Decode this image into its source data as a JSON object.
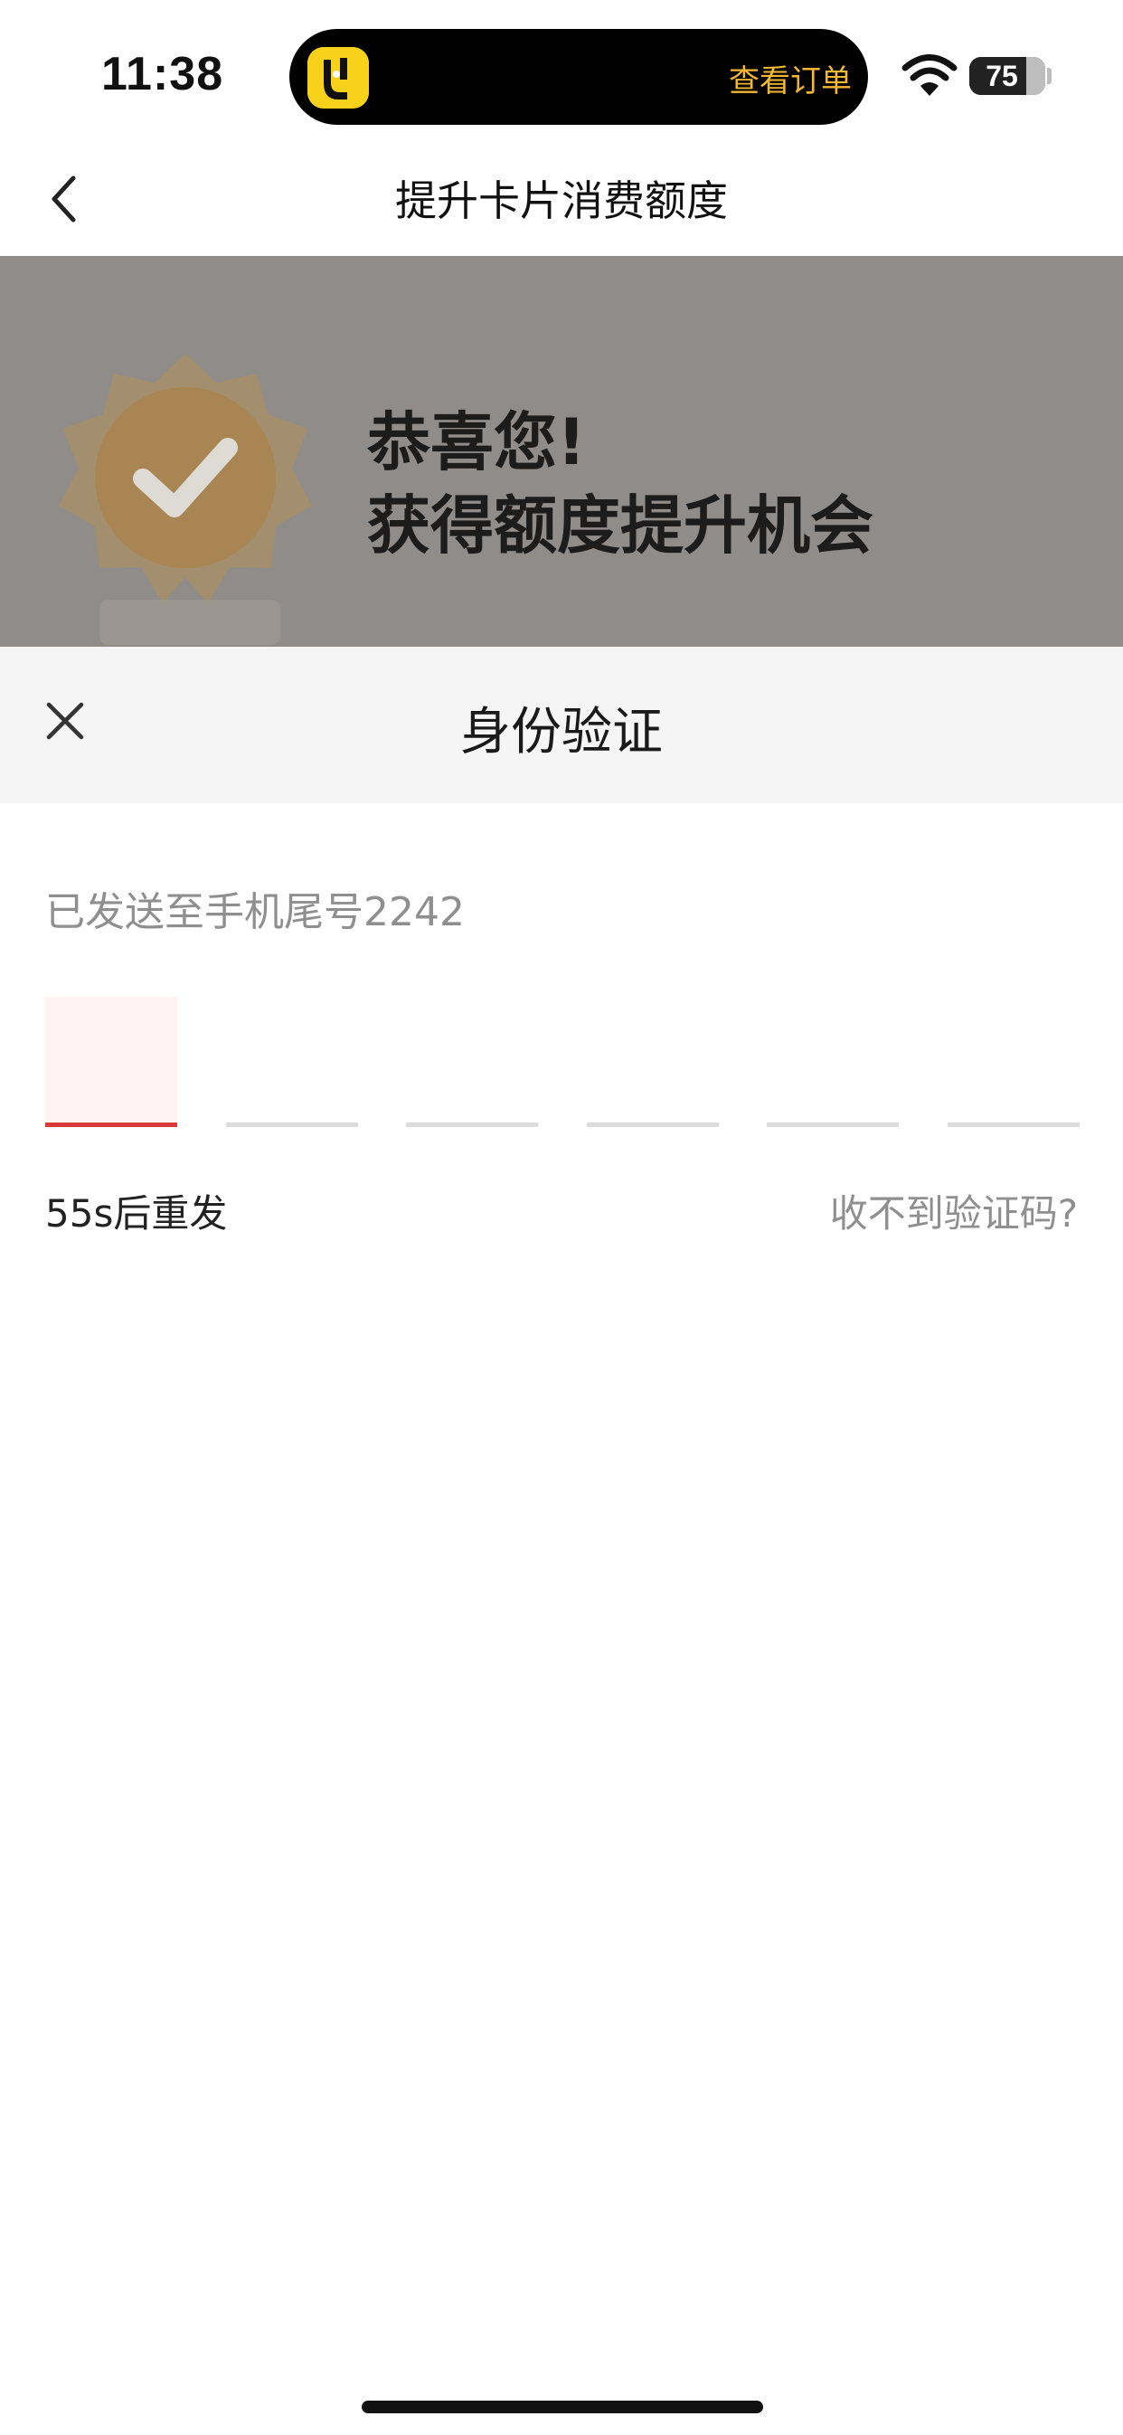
{
  "status_bar": {
    "time": "11:38",
    "island_action": "查看订单",
    "battery": 75
  },
  "nav": {
    "title": "提升卡片消费额度",
    "back_icon": "chevron-left-icon"
  },
  "banner": {
    "line1": "恭喜您!",
    "line2": "获得额度提升机会",
    "badge_icon": "verified-badge-icon"
  },
  "sheet": {
    "title": "身份验证",
    "close_icon": "close-icon",
    "sent_to": "已发送至手机尾号2242",
    "code_length": 6,
    "active_index": 0,
    "resend": "55s后重发",
    "no_code": "收不到验证码?"
  },
  "colors": {
    "accent": "#d8383a",
    "island_action": "#f2b733",
    "banner_dim": "#8f8c8a"
  }
}
